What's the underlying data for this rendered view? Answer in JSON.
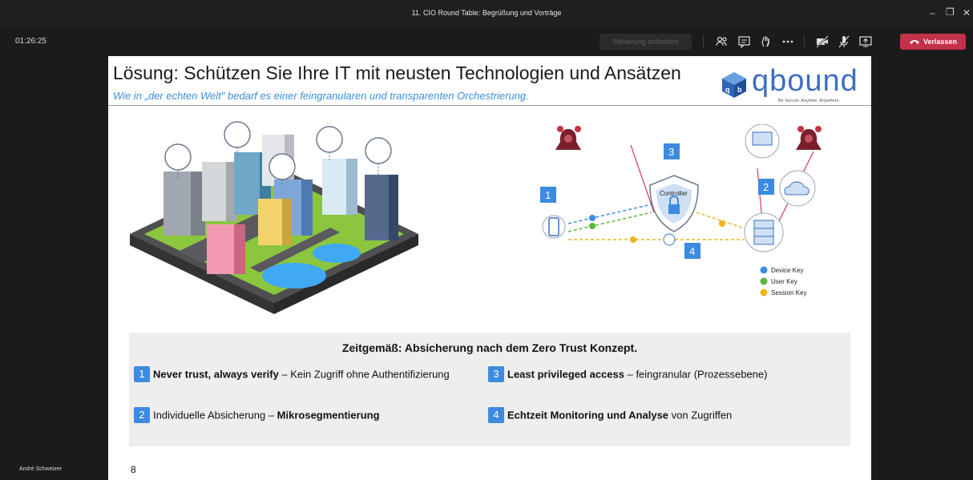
{
  "window": {
    "title": "11. CIO Round Table: Begrüßung und Vorträge"
  },
  "meeting": {
    "timer": "01:26:25",
    "control_request_label": "Steuerung anfordern",
    "leave_label": "Verlassen",
    "participant_name": "André Schweizer"
  },
  "slide": {
    "title": "Lösung: Schützen Sie Ihre IT mit neusten Technologien und Ansätzen",
    "subtitle": "Wie in „der echten Welt\" bedarf es einer feingranularen und transparenten Orchestrierung.",
    "logo_text": "qbound",
    "logo_tagline": "Be Secure. Anytime. Anywhere.",
    "page_number": "8",
    "diagram": {
      "controller_label": "Controller",
      "numbers": [
        "1",
        "2",
        "3",
        "4"
      ],
      "legend": [
        "Device Key",
        "User Key",
        "Session Key"
      ],
      "colors": {
        "device_key": "#3d8be0",
        "user_key": "#5bb53a",
        "session_key": "#f2b31c"
      }
    },
    "zero_trust": {
      "heading": "Zeitgemäß: Absicherung nach dem Zero Trust Konzept.",
      "items": [
        {
          "num": "1",
          "bold": "Never trust, always verify",
          "rest": " – Kein Zugriff ohne Authentifizierung"
        },
        {
          "num": "2",
          "pre": "Individuelle Absicherung – ",
          "bold": "Mikrosegmentierung"
        },
        {
          "num": "3",
          "bold": "Least privileged access",
          "rest": " – feingranular (Prozessebene)"
        },
        {
          "num": "4",
          "bold": "Echtzeit Monitoring und Analyse",
          "rest": " von Zugriffen"
        }
      ]
    }
  },
  "colors": {
    "accent": "#3d8be0",
    "leave": "#c4314b",
    "brand": "#3d6fc0"
  }
}
